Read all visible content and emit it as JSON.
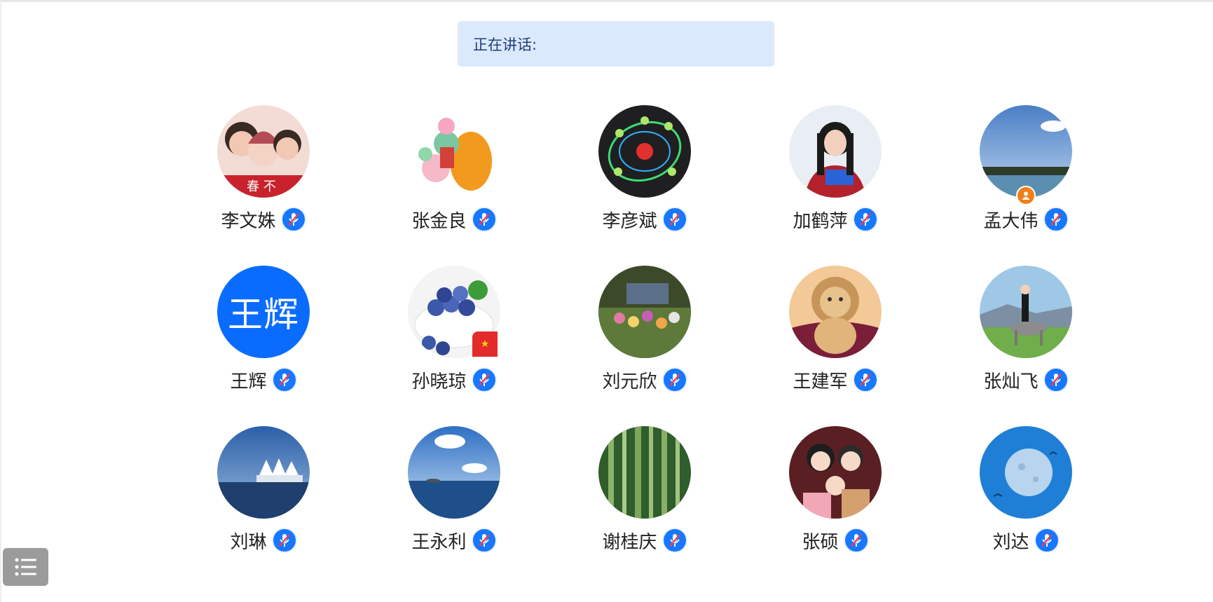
{
  "speaking": {
    "label": "正在讲话:"
  },
  "participants": [
    {
      "name": "李文姝",
      "avatar": "family-photo-avatar"
    },
    {
      "name": "张金良",
      "avatar": "carp-illustration-avatar"
    },
    {
      "name": "李彦斌",
      "avatar": "diagram-avatar"
    },
    {
      "name": "加鹤萍",
      "avatar": "woman-portrait-avatar"
    },
    {
      "name": "孟大伟",
      "avatar": "lake-sky-avatar",
      "badge": "host-badge-icon"
    },
    {
      "name": "王辉",
      "avatar_text": "王辉",
      "avatar_color": "#0a6cff"
    },
    {
      "name": "孙晓琼",
      "avatar": "blueberries-avatar",
      "badge": "china-flag-icon"
    },
    {
      "name": "刘元欣",
      "avatar": "flower-garden-avatar"
    },
    {
      "name": "王建军",
      "avatar": "lion-plush-avatar"
    },
    {
      "name": "张灿飞",
      "avatar": "horse-rider-avatar"
    },
    {
      "name": "刘琳",
      "avatar": "harbor-sails-avatar"
    },
    {
      "name": "王永利",
      "avatar": "sea-sky-avatar"
    },
    {
      "name": "谢桂庆",
      "avatar": "bamboo-forest-avatar"
    },
    {
      "name": "张硕",
      "avatar": "cartoon-family-avatar"
    },
    {
      "name": "刘达",
      "avatar": "moon-avatar"
    }
  ],
  "icons": {
    "mic": "mic-muted-icon",
    "menu": "list-menu-icon"
  },
  "colors": {
    "accent": "#1677ff",
    "speaking_bg": "#dbe9fd",
    "host_badge": "#f07f1a"
  }
}
